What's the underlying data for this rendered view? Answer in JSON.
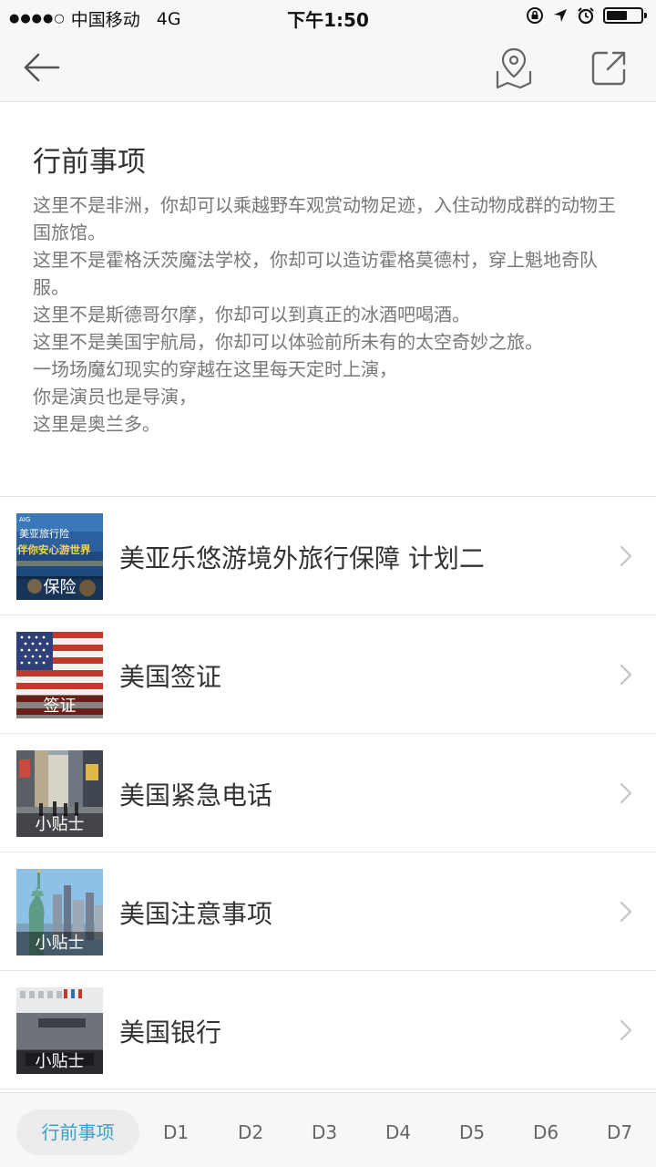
{
  "status": {
    "signal_dots": "●●●●○",
    "carrier": "中国移动",
    "network": "4G",
    "time": "下午1:50"
  },
  "nav": {
    "back_icon": "arrow-left-icon",
    "map_icon": "map-pin-icon",
    "share_icon": "share-icon"
  },
  "intro": {
    "title": "行前事项",
    "lines": [
      "这里不是非洲，你却可以乘越野车观赏动物足迹，入住动物成群的动物王国旅馆。",
      "这里不是霍格沃茨魔法学校，你却可以造访霍格莫德村，穿上魁地奇队服。",
      "这里不是斯德哥尔摩，你却可以到真正的冰酒吧喝酒。",
      "这里不是美国宇航局，你却可以体验前所未有的太空奇妙之旅。",
      "一场场魔幻现实的穿越在这里每天定时上演，",
      "你是演员也是导演，",
      "这里是奥兰多。"
    ]
  },
  "list": [
    {
      "title": "美亚乐悠游境外旅行保障 计划二",
      "badge": "保险",
      "thumb_text_1": "美亚旅行险",
      "thumb_text_2": "伴你安心游世界",
      "thumb_text_3": "AIG"
    },
    {
      "title": "美国签证",
      "badge": "签证"
    },
    {
      "title": "美国紧急电话",
      "badge": "小贴士"
    },
    {
      "title": "美国注意事项",
      "badge": "小贴士"
    },
    {
      "title": "美国银行",
      "badge": "小贴士"
    }
  ],
  "tabs": [
    "行前事项",
    "D1",
    "D2",
    "D3",
    "D4",
    "D5",
    "D6",
    "D7"
  ],
  "colors": {
    "active_tab_text": "#3aa0c8",
    "body_text": "#777777",
    "title_text": "#333333"
  }
}
